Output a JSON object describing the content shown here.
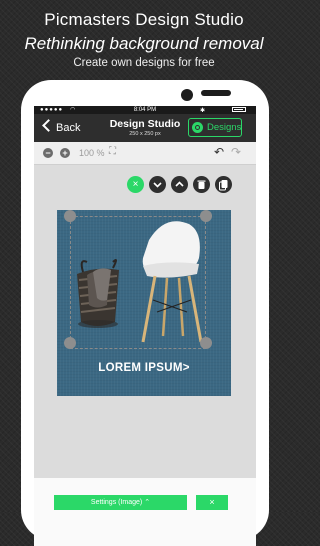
{
  "promo": {
    "headline": "Picmasters Design Studio",
    "tagline": "Rethinking background removal",
    "subline": "Create own designs for free"
  },
  "status_bar": {
    "time": "8:04 PM"
  },
  "nav": {
    "back_label": "Back",
    "title": "Design Studio",
    "subtitle": "250 x 250 px",
    "designs_label": "Designs"
  },
  "toolbar": {
    "zoom_out": "−",
    "zoom_in": "+",
    "zoom_level": "100 %",
    "fit_icon": "fit-to-screen-icon",
    "undo_icon": "undo-icon",
    "redo_icon": "redo-icon"
  },
  "layer_tools": {
    "close": "×",
    "move_down": "⌄",
    "move_up": "⌃",
    "delete_icon": "trash-icon",
    "duplicate_icon": "duplicate-icon"
  },
  "design": {
    "caption": "LOREM IPSUM>",
    "background_color": "#3b6883"
  },
  "bottom_bar": {
    "settings_label": "Settings (Image)  ⌃",
    "close_label": "×"
  },
  "colors": {
    "accent": "#2bd868",
    "nav_bg": "#2e2e2e"
  }
}
